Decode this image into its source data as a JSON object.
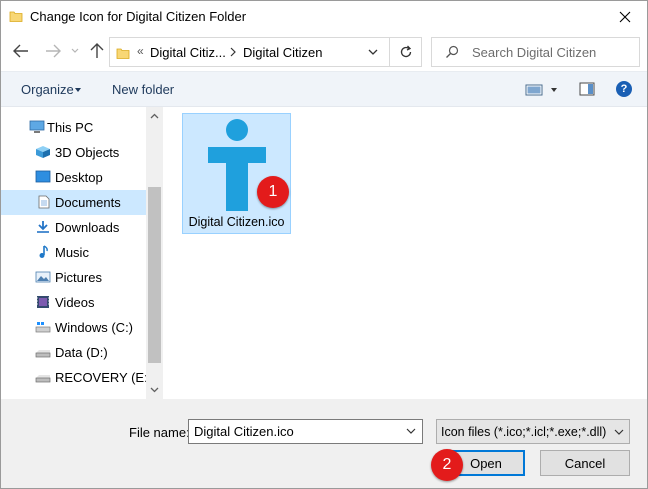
{
  "window": {
    "title": "Change Icon for Digital Citizen Folder"
  },
  "address": {
    "overflow": "«",
    "crumbs": [
      "Digital Citiz...",
      "Digital Citizen"
    ]
  },
  "search": {
    "placeholder": "Search Digital Citizen"
  },
  "toolbar": {
    "organize_label": "Organize",
    "new_folder_label": "New folder",
    "help_label": "?"
  },
  "sidebar": {
    "items": [
      {
        "label": "This PC",
        "icon": "pc-icon",
        "selected": false
      },
      {
        "label": "3D Objects",
        "icon": "3d-objects-icon",
        "selected": false
      },
      {
        "label": "Desktop",
        "icon": "desktop-icon",
        "selected": false
      },
      {
        "label": "Documents",
        "icon": "documents-icon",
        "selected": true
      },
      {
        "label": "Downloads",
        "icon": "downloads-icon",
        "selected": false
      },
      {
        "label": "Music",
        "icon": "music-icon",
        "selected": false
      },
      {
        "label": "Pictures",
        "icon": "pictures-icon",
        "selected": false
      },
      {
        "label": "Videos",
        "icon": "videos-icon",
        "selected": false
      },
      {
        "label": "Windows (C:)",
        "icon": "drive-c-icon",
        "selected": false
      },
      {
        "label": "Data (D:)",
        "icon": "drive-icon",
        "selected": false
      },
      {
        "label": "RECOVERY (E:)",
        "icon": "drive-icon",
        "selected": false
      }
    ]
  },
  "files": [
    {
      "name": "Digital Citizen.ico",
      "icon": "digital-citizen-logo-icon",
      "selected": true
    }
  ],
  "annotations": {
    "badge1": "1",
    "badge2": "2"
  },
  "footer": {
    "file_name_label": "File name:",
    "file_name_value": "Digital Citizen.ico",
    "file_type_value": "Icon files (*.ico;*.icl;*.exe;*.dll)",
    "open_label": "Open",
    "cancel_label": "Cancel"
  },
  "colors": {
    "selection": "#cce8ff",
    "logo": "#1fa0dd",
    "badge": "#e31b1b",
    "accent": "#0078d7"
  }
}
